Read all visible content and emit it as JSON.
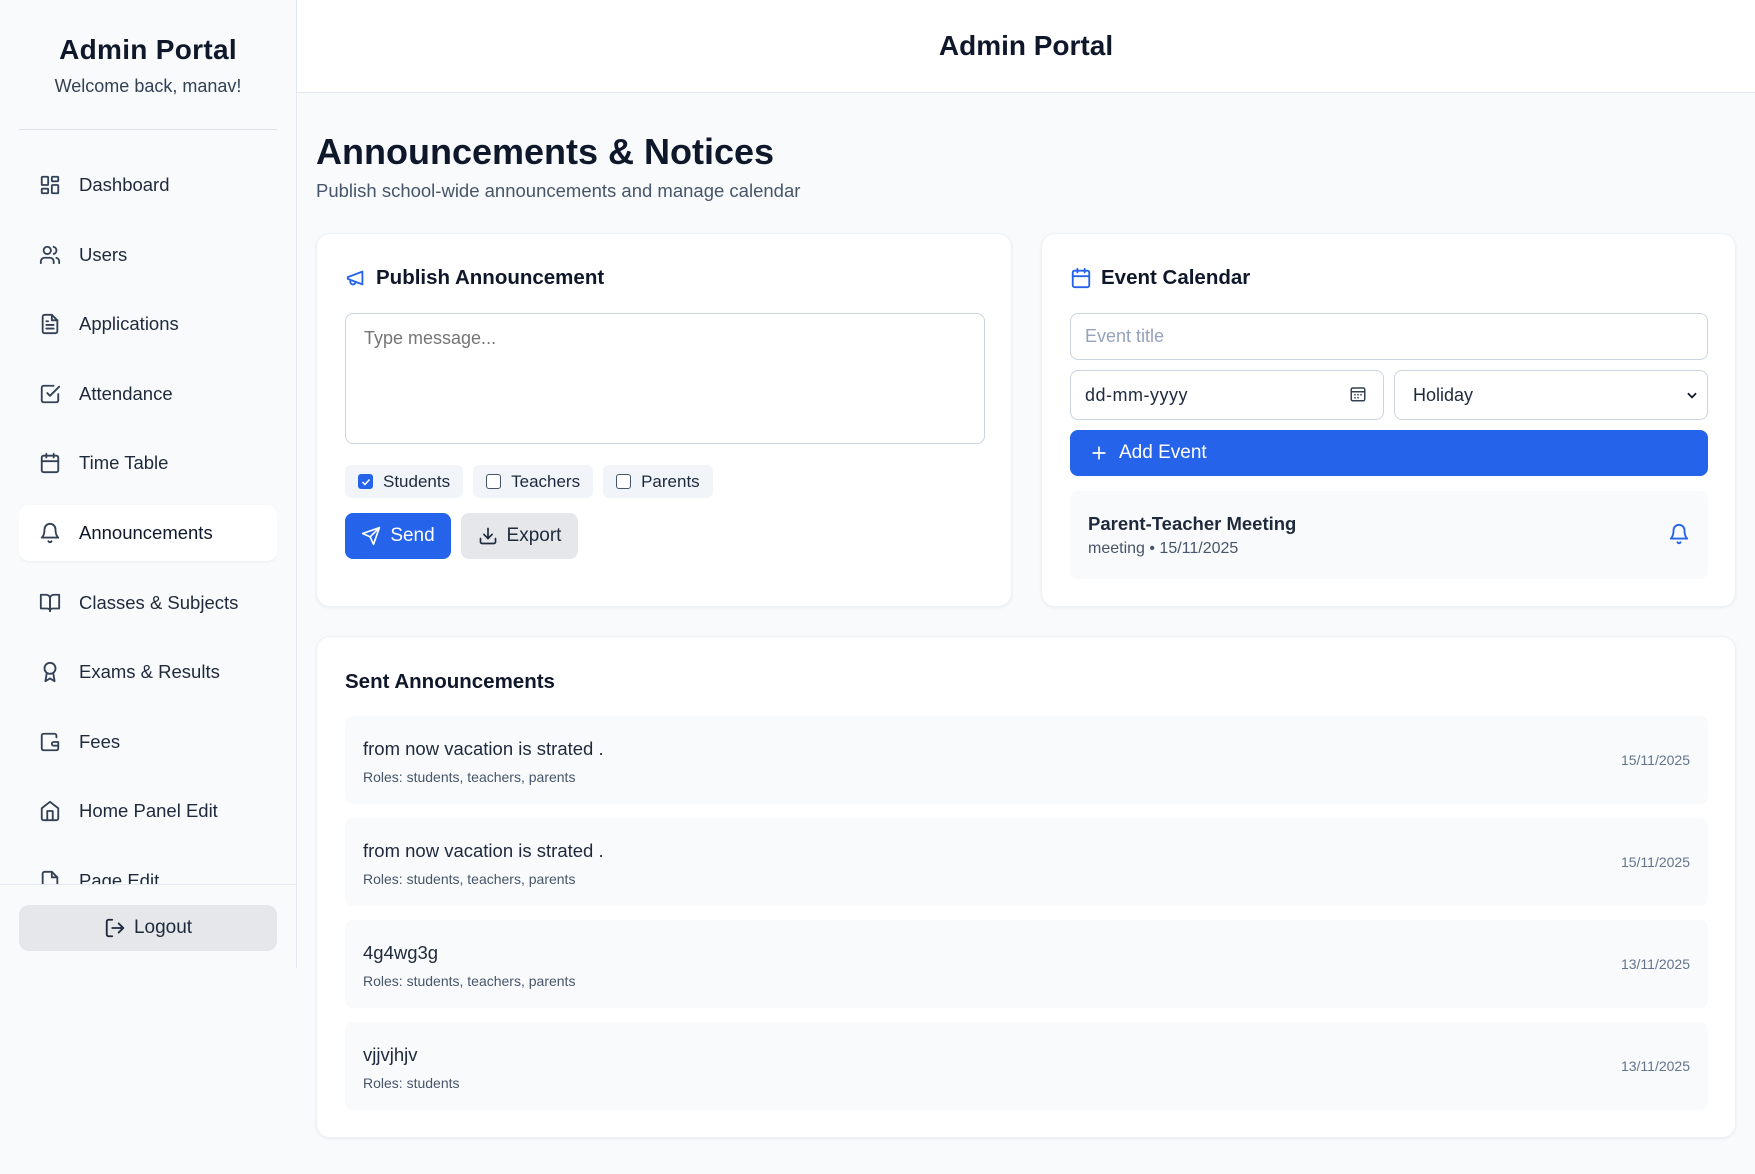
{
  "sidebar": {
    "title": "Admin Portal",
    "welcome": "Welcome back, manav!",
    "items": [
      {
        "label": "Dashboard",
        "icon": "dashboard-icon"
      },
      {
        "label": "Users",
        "icon": "users-icon"
      },
      {
        "label": "Applications",
        "icon": "file-text-icon"
      },
      {
        "label": "Attendance",
        "icon": "check-square-icon"
      },
      {
        "label": "Time Table",
        "icon": "calendar-icon"
      },
      {
        "label": "Announcements",
        "icon": "bell-icon",
        "active": true
      },
      {
        "label": "Classes & Subjects",
        "icon": "book-open-icon"
      },
      {
        "label": "Exams & Results",
        "icon": "award-icon"
      },
      {
        "label": "Fees",
        "icon": "wallet-icon"
      },
      {
        "label": "Home Panel Edit",
        "icon": "home-icon"
      },
      {
        "label": "Page Edit",
        "icon": "file-edit-icon"
      }
    ],
    "logout_label": "Logout"
  },
  "header": {
    "title": "Admin Portal"
  },
  "page": {
    "title": "Announcements & Notices",
    "subtitle": "Publish school-wide announcements and manage calendar"
  },
  "publish": {
    "title": "Publish Announcement",
    "message_placeholder": "Type message...",
    "roles": [
      {
        "label": "Students",
        "checked": true
      },
      {
        "label": "Teachers",
        "checked": false
      },
      {
        "label": "Parents",
        "checked": false
      }
    ],
    "send_label": "Send",
    "export_label": "Export"
  },
  "calendar": {
    "title": "Event Calendar",
    "event_title_placeholder": "Event title",
    "date_placeholder": "dd-mm-yyyy",
    "type_selected": "Holiday",
    "add_label": "Add Event",
    "events": [
      {
        "title": "Parent-Teacher Meeting",
        "meta": "meeting • 15/11/2025"
      }
    ]
  },
  "sent": {
    "title": "Sent Announcements",
    "items": [
      {
        "message": "from now vacation is strated .",
        "roles": "Roles: students, teachers, parents",
        "date": "15/11/2025"
      },
      {
        "message": "from now vacation is strated .",
        "roles": "Roles: students, teachers, parents",
        "date": "15/11/2025"
      },
      {
        "message": "4g4wg3g",
        "roles": "Roles: students, teachers, parents",
        "date": "13/11/2025"
      },
      {
        "message": "vjjvjhjv",
        "roles": "Roles: students",
        "date": "13/11/2025"
      }
    ]
  },
  "colors": {
    "accent": "#2563eb",
    "background": "#f8fafc",
    "card": "#ffffff"
  }
}
